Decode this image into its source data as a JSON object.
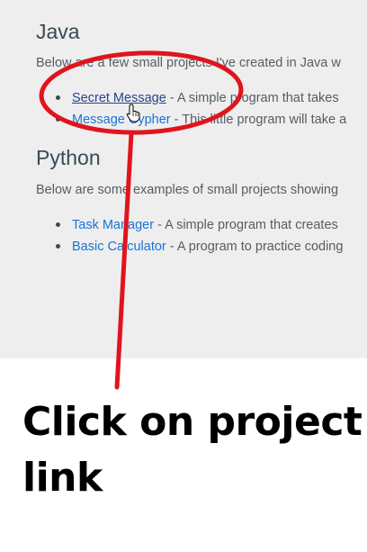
{
  "java": {
    "heading": "Java",
    "description": "Below are a few small projects I've created in Java w",
    "projects": [
      {
        "link": "Secret Message",
        "desc": " - A simple program that takes"
      },
      {
        "link": "Message Cypher",
        "desc": " - This little program will take a"
      }
    ]
  },
  "python": {
    "heading": "Python",
    "description": "Below are some examples of small projects showing",
    "projects": [
      {
        "link": "Task Manager",
        "desc": " - A simple program that creates"
      },
      {
        "link": "Basic Calculator",
        "desc": " - A program to practice coding"
      }
    ]
  },
  "annotation": {
    "instruction": "Click on project link",
    "highlight_color": "#e0141e"
  },
  "colors": {
    "link": "#1a73d6",
    "visited_link": "#28448a",
    "page_background": "#eeeeee"
  }
}
